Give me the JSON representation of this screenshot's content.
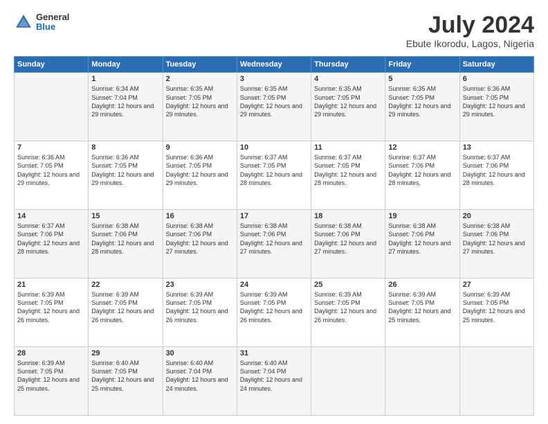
{
  "header": {
    "logo_line1": "General",
    "logo_line2": "Blue",
    "month_year": "July 2024",
    "location": "Ebute Ikorodu, Lagos, Nigeria"
  },
  "days_of_week": [
    "Sunday",
    "Monday",
    "Tuesday",
    "Wednesday",
    "Thursday",
    "Friday",
    "Saturday"
  ],
  "weeks": [
    [
      {
        "day": "",
        "sunrise": "",
        "sunset": "",
        "daylight": ""
      },
      {
        "day": "1",
        "sunrise": "Sunrise: 6:34 AM",
        "sunset": "Sunset: 7:04 PM",
        "daylight": "Daylight: 12 hours and 29 minutes."
      },
      {
        "day": "2",
        "sunrise": "Sunrise: 6:35 AM",
        "sunset": "Sunset: 7:05 PM",
        "daylight": "Daylight: 12 hours and 29 minutes."
      },
      {
        "day": "3",
        "sunrise": "Sunrise: 6:35 AM",
        "sunset": "Sunset: 7:05 PM",
        "daylight": "Daylight: 12 hours and 29 minutes."
      },
      {
        "day": "4",
        "sunrise": "Sunrise: 6:35 AM",
        "sunset": "Sunset: 7:05 PM",
        "daylight": "Daylight: 12 hours and 29 minutes."
      },
      {
        "day": "5",
        "sunrise": "Sunrise: 6:35 AM",
        "sunset": "Sunset: 7:05 PM",
        "daylight": "Daylight: 12 hours and 29 minutes."
      },
      {
        "day": "6",
        "sunrise": "Sunrise: 6:36 AM",
        "sunset": "Sunset: 7:05 PM",
        "daylight": "Daylight: 12 hours and 29 minutes."
      }
    ],
    [
      {
        "day": "7",
        "sunrise": "Sunrise: 6:36 AM",
        "sunset": "Sunset: 7:05 PM",
        "daylight": "Daylight: 12 hours and 29 minutes."
      },
      {
        "day": "8",
        "sunrise": "Sunrise: 6:36 AM",
        "sunset": "Sunset: 7:05 PM",
        "daylight": "Daylight: 12 hours and 29 minutes."
      },
      {
        "day": "9",
        "sunrise": "Sunrise: 6:36 AM",
        "sunset": "Sunset: 7:05 PM",
        "daylight": "Daylight: 12 hours and 29 minutes."
      },
      {
        "day": "10",
        "sunrise": "Sunrise: 6:37 AM",
        "sunset": "Sunset: 7:05 PM",
        "daylight": "Daylight: 12 hours and 28 minutes."
      },
      {
        "day": "11",
        "sunrise": "Sunrise: 6:37 AM",
        "sunset": "Sunset: 7:05 PM",
        "daylight": "Daylight: 12 hours and 28 minutes."
      },
      {
        "day": "12",
        "sunrise": "Sunrise: 6:37 AM",
        "sunset": "Sunset: 7:06 PM",
        "daylight": "Daylight: 12 hours and 28 minutes."
      },
      {
        "day": "13",
        "sunrise": "Sunrise: 6:37 AM",
        "sunset": "Sunset: 7:06 PM",
        "daylight": "Daylight: 12 hours and 28 minutes."
      }
    ],
    [
      {
        "day": "14",
        "sunrise": "Sunrise: 6:37 AM",
        "sunset": "Sunset: 7:06 PM",
        "daylight": "Daylight: 12 hours and 28 minutes."
      },
      {
        "day": "15",
        "sunrise": "Sunrise: 6:38 AM",
        "sunset": "Sunset: 7:06 PM",
        "daylight": "Daylight: 12 hours and 28 minutes."
      },
      {
        "day": "16",
        "sunrise": "Sunrise: 6:38 AM",
        "sunset": "Sunset: 7:06 PM",
        "daylight": "Daylight: 12 hours and 27 minutes."
      },
      {
        "day": "17",
        "sunrise": "Sunrise: 6:38 AM",
        "sunset": "Sunset: 7:06 PM",
        "daylight": "Daylight: 12 hours and 27 minutes."
      },
      {
        "day": "18",
        "sunrise": "Sunrise: 6:38 AM",
        "sunset": "Sunset: 7:06 PM",
        "daylight": "Daylight: 12 hours and 27 minutes."
      },
      {
        "day": "19",
        "sunrise": "Sunrise: 6:38 AM",
        "sunset": "Sunset: 7:06 PM",
        "daylight": "Daylight: 12 hours and 27 minutes."
      },
      {
        "day": "20",
        "sunrise": "Sunrise: 6:38 AM",
        "sunset": "Sunset: 7:06 PM",
        "daylight": "Daylight: 12 hours and 27 minutes."
      }
    ],
    [
      {
        "day": "21",
        "sunrise": "Sunrise: 6:39 AM",
        "sunset": "Sunset: 7:05 PM",
        "daylight": "Daylight: 12 hours and 26 minutes."
      },
      {
        "day": "22",
        "sunrise": "Sunrise: 6:39 AM",
        "sunset": "Sunset: 7:05 PM",
        "daylight": "Daylight: 12 hours and 26 minutes."
      },
      {
        "day": "23",
        "sunrise": "Sunrise: 6:39 AM",
        "sunset": "Sunset: 7:05 PM",
        "daylight": "Daylight: 12 hours and 26 minutes."
      },
      {
        "day": "24",
        "sunrise": "Sunrise: 6:39 AM",
        "sunset": "Sunset: 7:05 PM",
        "daylight": "Daylight: 12 hours and 26 minutes."
      },
      {
        "day": "25",
        "sunrise": "Sunrise: 6:39 AM",
        "sunset": "Sunset: 7:05 PM",
        "daylight": "Daylight: 12 hours and 26 minutes."
      },
      {
        "day": "26",
        "sunrise": "Sunrise: 6:39 AM",
        "sunset": "Sunset: 7:05 PM",
        "daylight": "Daylight: 12 hours and 25 minutes."
      },
      {
        "day": "27",
        "sunrise": "Sunrise: 6:39 AM",
        "sunset": "Sunset: 7:05 PM",
        "daylight": "Daylight: 12 hours and 25 minutes."
      }
    ],
    [
      {
        "day": "28",
        "sunrise": "Sunrise: 6:39 AM",
        "sunset": "Sunset: 7:05 PM",
        "daylight": "Daylight: 12 hours and 25 minutes."
      },
      {
        "day": "29",
        "sunrise": "Sunrise: 6:40 AM",
        "sunset": "Sunset: 7:05 PM",
        "daylight": "Daylight: 12 hours and 25 minutes."
      },
      {
        "day": "30",
        "sunrise": "Sunrise: 6:40 AM",
        "sunset": "Sunset: 7:04 PM",
        "daylight": "Daylight: 12 hours and 24 minutes."
      },
      {
        "day": "31",
        "sunrise": "Sunrise: 6:40 AM",
        "sunset": "Sunset: 7:04 PM",
        "daylight": "Daylight: 12 hours and 24 minutes."
      },
      {
        "day": "",
        "sunrise": "",
        "sunset": "",
        "daylight": ""
      },
      {
        "day": "",
        "sunrise": "",
        "sunset": "",
        "daylight": ""
      },
      {
        "day": "",
        "sunrise": "",
        "sunset": "",
        "daylight": ""
      }
    ]
  ]
}
